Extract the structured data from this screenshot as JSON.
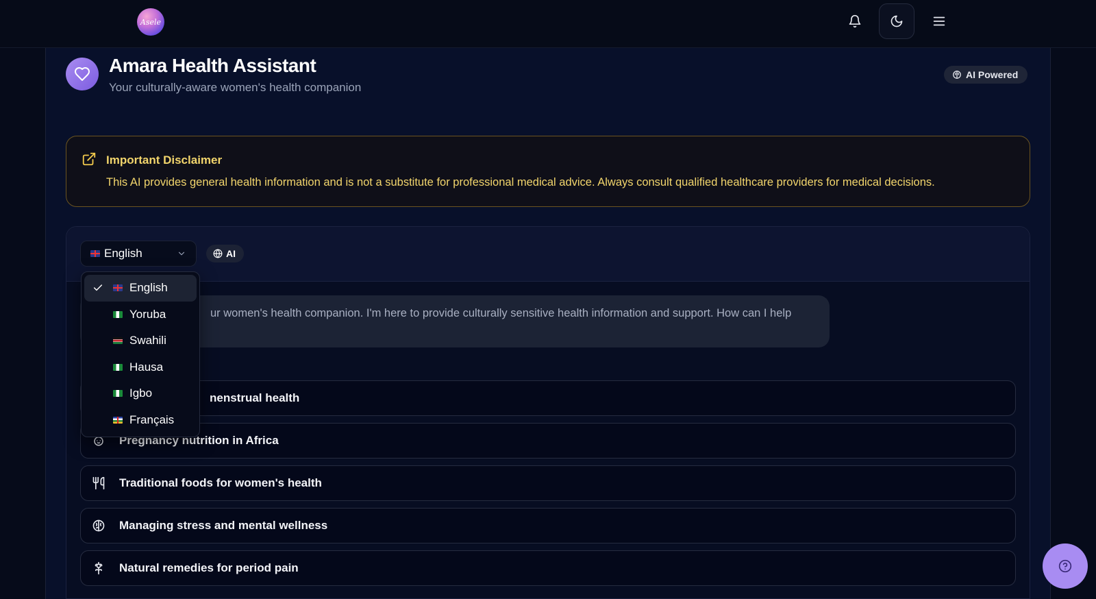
{
  "header": {
    "logo_text": "Asele",
    "icons": [
      "bell-icon",
      "moon-icon",
      "menu-icon"
    ]
  },
  "assistant": {
    "title": "Amara Health Assistant",
    "subtitle": "Your culturally-aware women's health companion",
    "badge": "AI Powered"
  },
  "disclaimer": {
    "title": "Important Disclaimer",
    "text": "This AI provides general health information and is not a substitute for professional medical advice. Always consult qualified healthcare providers for medical decisions."
  },
  "chat": {
    "language_selected": "English",
    "ai_chip": "AI",
    "message_visible": "ur women's health companion. I'm here to provide culturally sensitive health information and support. How can I help"
  },
  "language_options": [
    {
      "label": "English",
      "flag": "uk",
      "selected": true
    },
    {
      "label": "Yoruba",
      "flag": "ng",
      "selected": false
    },
    {
      "label": "Swahili",
      "flag": "ke",
      "selected": false
    },
    {
      "label": "Hausa",
      "flag": "ng",
      "selected": false
    },
    {
      "label": "Igbo",
      "flag": "ng",
      "selected": false
    },
    {
      "label": "Français",
      "flag": "cf",
      "selected": false
    }
  ],
  "suggestions": [
    {
      "label": "nenstrual health",
      "icon": "heart-icon"
    },
    {
      "label": "Pregnancy nutrition in Africa",
      "icon": "baby-icon"
    },
    {
      "label": "Traditional foods for women's health",
      "icon": "utensils-icon"
    },
    {
      "label": "Managing stress and mental wellness",
      "icon": "brain-icon"
    },
    {
      "label": "Natural remedies for period pain",
      "icon": "flower-icon"
    }
  ],
  "colors": {
    "background": "#060b1a",
    "accent": "#a88cf2",
    "warning": "#f2d56c"
  }
}
